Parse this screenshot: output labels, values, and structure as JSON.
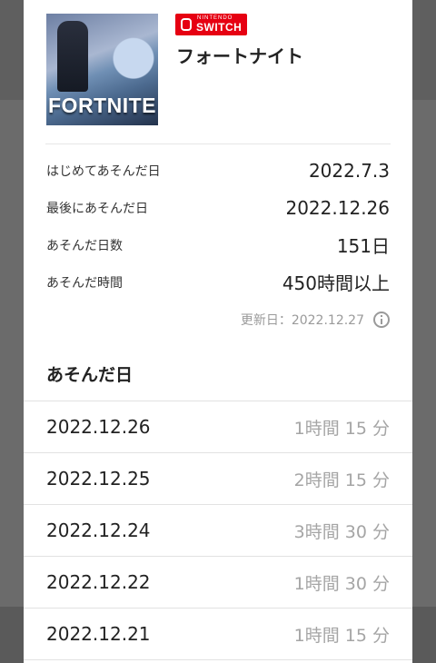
{
  "game": {
    "cover_text": "FORTNITE",
    "platform_badge_top": "NINTENDO",
    "platform_badge_main": "SWITCH",
    "title": "フォートナイト"
  },
  "stats": [
    {
      "label": "はじめてあそんだ日",
      "value": "2022.7.3"
    },
    {
      "label": "最後にあそんだ日",
      "value": "2022.12.26"
    },
    {
      "label": "あそんだ日数",
      "value": "151日"
    },
    {
      "label": "あそんだ時間",
      "value": "450時間以上"
    }
  ],
  "updated": "更新日：2022.12.27",
  "played_days": {
    "title": "あそんだ日",
    "rows": [
      {
        "date": "2022.12.26",
        "duration": "1時間 15 分"
      },
      {
        "date": "2022.12.25",
        "duration": "2時間 15 分"
      },
      {
        "date": "2022.12.24",
        "duration": "3時間 30 分"
      },
      {
        "date": "2022.12.22",
        "duration": "1時間 30 分"
      },
      {
        "date": "2022.12.21",
        "duration": "1時間 15 分"
      }
    ]
  }
}
